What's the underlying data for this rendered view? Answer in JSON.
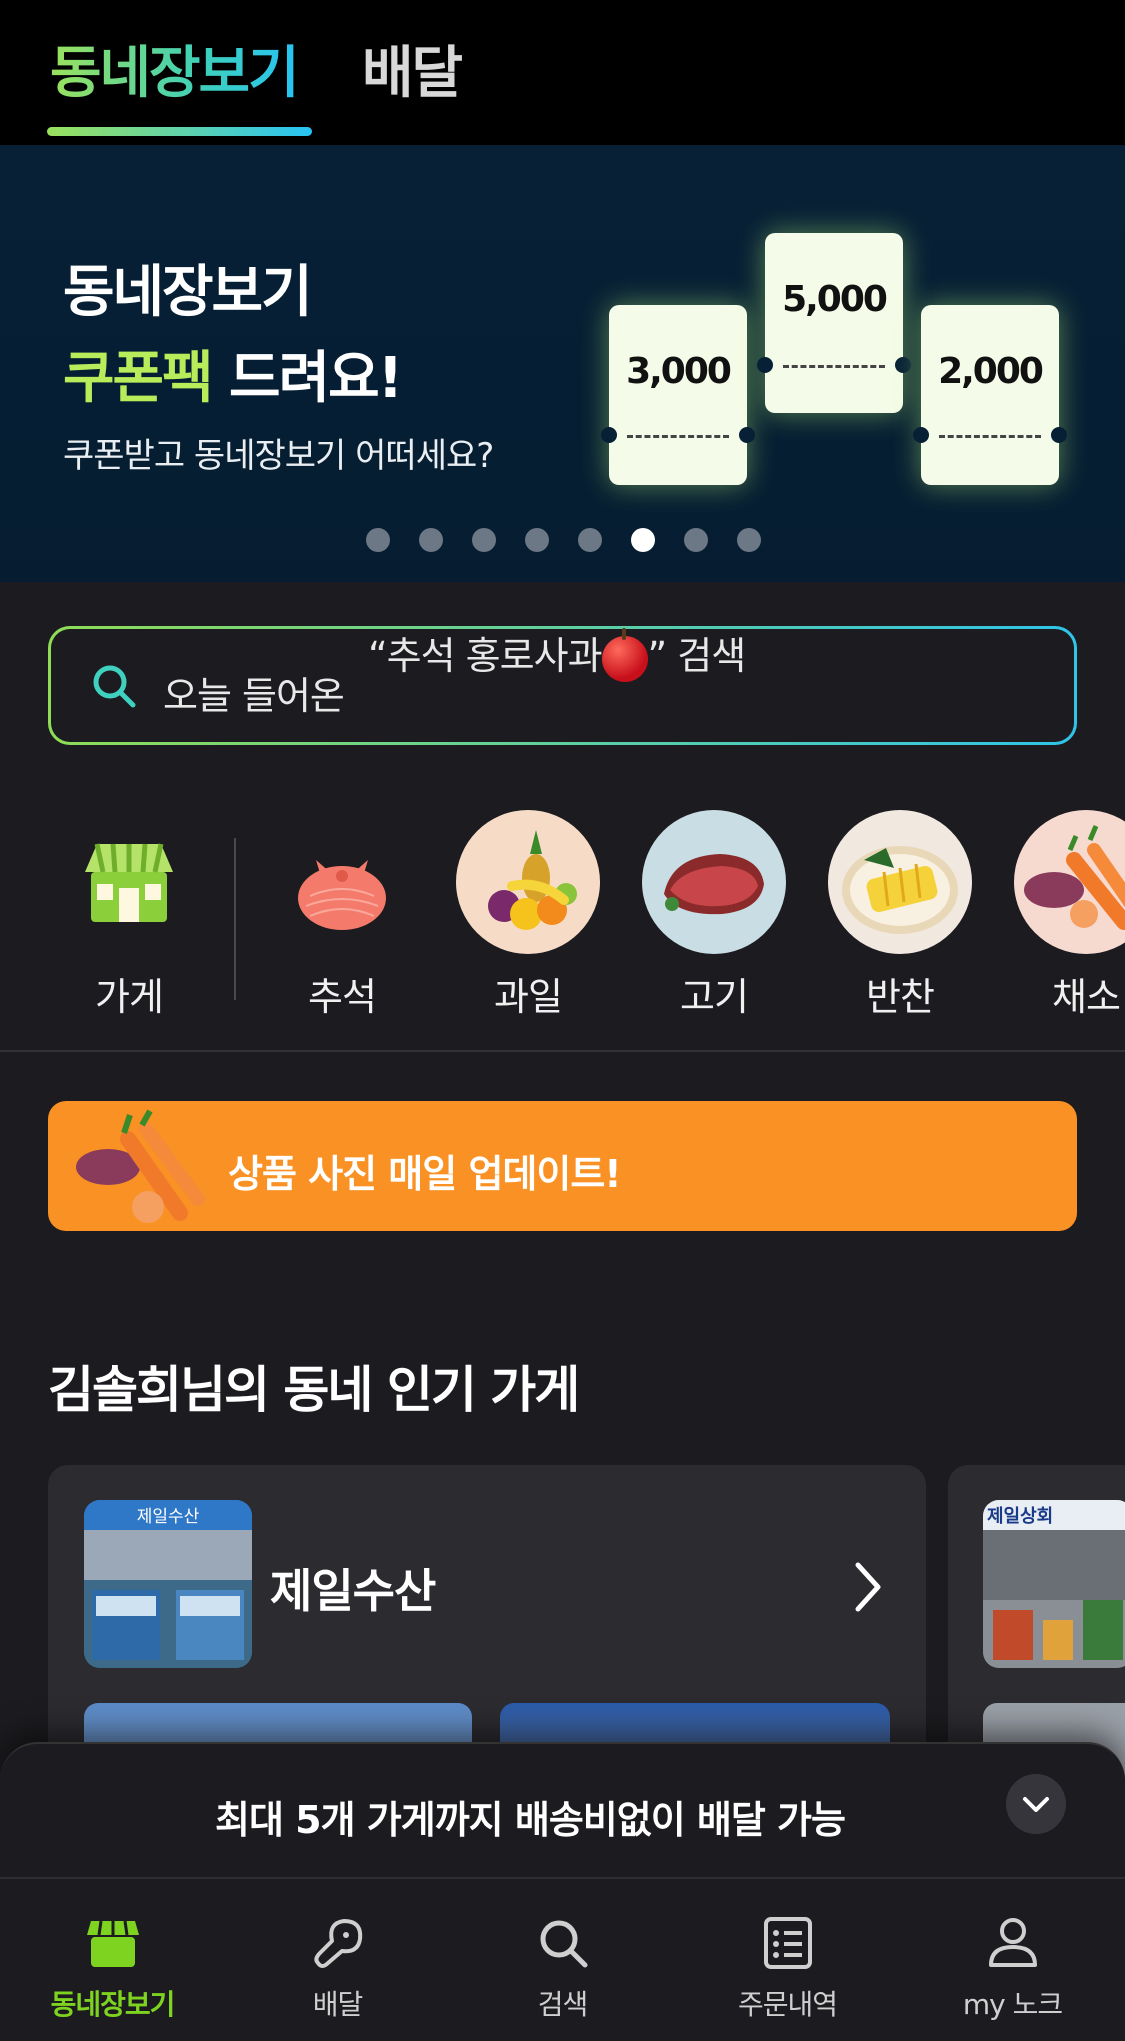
{
  "tabs": {
    "active": "동네장보기",
    "inactive": "배달"
  },
  "banner": {
    "line1": "동네장보기",
    "line2_highlight": "쿠폰팩",
    "line2_rest": " 드려요!",
    "subtitle": "쿠폰받고 동네장보기 어떠세요?",
    "coupons": [
      "3,000",
      "5,000",
      "2,000"
    ],
    "page_count": 8,
    "active_page": 6
  },
  "search": {
    "text_prefix": "오늘 들어온",
    "text_quote": "“추석 홍로사과",
    "text_suffix": "” 검색"
  },
  "categories": [
    {
      "label": "가게",
      "icon": "store-icon"
    },
    {
      "label": "추석",
      "icon": "gift-bundle-icon"
    },
    {
      "label": "과일",
      "icon": "fruit-icon"
    },
    {
      "label": "고기",
      "icon": "meat-icon"
    },
    {
      "label": "반찬",
      "icon": "side-dish-icon"
    },
    {
      "label": "채소",
      "icon": "vegetable-icon"
    }
  ],
  "promo": {
    "text": "상품 사진 매일 업데이트!"
  },
  "section": {
    "title": "김솔희님의 동네 인기 가게"
  },
  "stores": [
    {
      "name": "제일수산",
      "sign": "제일수산"
    },
    {
      "name": "",
      "sign": "제일상회"
    }
  ],
  "sheet": {
    "text": "최대 5개 가게까지 배송비없이 배달 가능"
  },
  "nav": [
    {
      "label": "동네장보기",
      "icon": "storefront-icon",
      "active": true
    },
    {
      "label": "배달",
      "icon": "drumstick-icon",
      "active": false
    },
    {
      "label": "검색",
      "icon": "search-icon",
      "active": false
    },
    {
      "label": "주문내역",
      "icon": "order-list-icon",
      "active": false
    },
    {
      "label": "my 노크",
      "icon": "profile-icon",
      "active": false
    }
  ],
  "colors": {
    "accent_green": "#7ed321",
    "promo_orange": "#f99124",
    "banner_bg": "#072036"
  }
}
